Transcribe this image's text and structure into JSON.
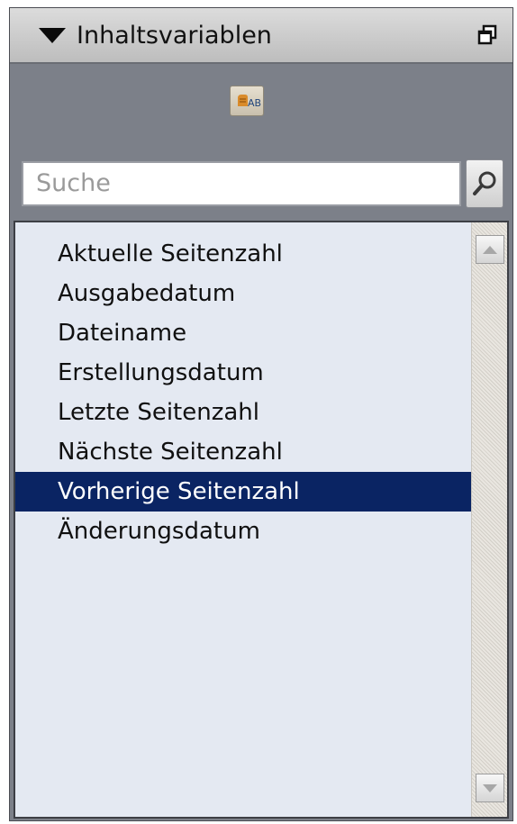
{
  "panel": {
    "title": "Inhaltsvariablen",
    "collapse_icon": "triangle-down-icon",
    "float_icon": "float-window-icon"
  },
  "toolbar": {
    "insert_icon": "insert-variable-icon"
  },
  "search": {
    "placeholder": "Suche",
    "button_icon": "magnifier-icon"
  },
  "list": {
    "items": [
      {
        "label": "Aktuelle Seitenzahl"
      },
      {
        "label": "Ausgabedatum"
      },
      {
        "label": "Dateiname"
      },
      {
        "label": "Erstellungsdatum"
      },
      {
        "label": "Letzte Seitenzahl"
      },
      {
        "label": "Nächste Seitenzahl"
      },
      {
        "label": "Vorherige Seitenzahl"
      },
      {
        "label": "Änderungsdatum"
      }
    ],
    "selected_index": 6,
    "selection_color": "#0a2463"
  },
  "scrollbar": {
    "up_icon": "scroll-up-arrow-icon",
    "down_icon": "scroll-down-arrow-icon"
  }
}
